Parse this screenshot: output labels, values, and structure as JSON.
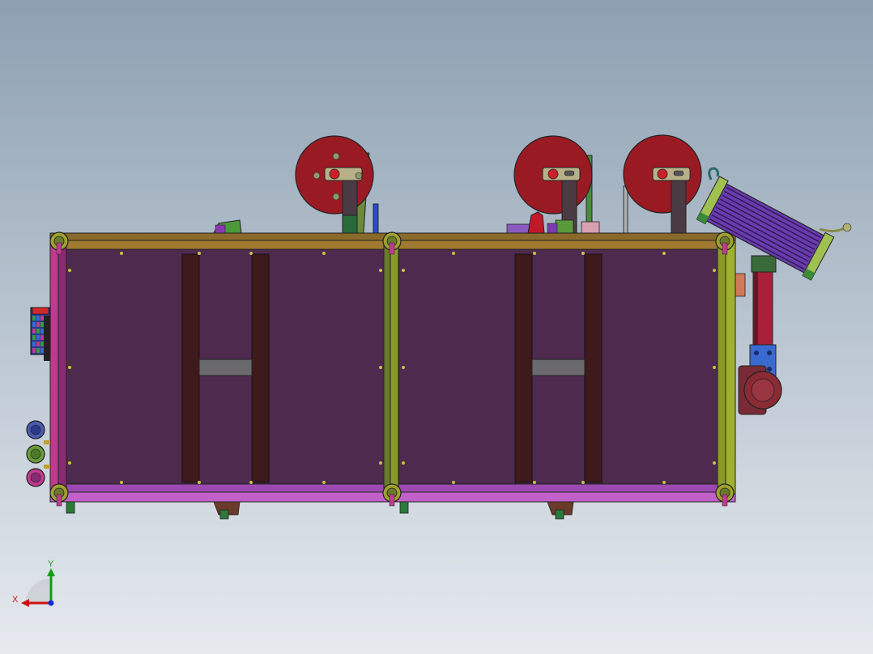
{
  "triad": {
    "x_label": "X",
    "y_label": "Y"
  },
  "colors": {
    "bg_top": "#8da0b2",
    "bg_bottom": "#e6eaef",
    "frame_rail": "#8a6a2a",
    "panel": "#4e2a4f",
    "post_pink": "#c03a8f",
    "post_green": "#8a9a2a",
    "reel_red": "#9a1a24",
    "support_bar": "#3e1a1c",
    "crossbar": "#6a6a6e",
    "conveyor_purple": "#6a3ab0",
    "motor_red": "#8a2a34",
    "motor_blue": "#3a6ad0",
    "x_axis": "#d01010",
    "y_axis": "#10a010",
    "z_axis": "#1030d0"
  }
}
